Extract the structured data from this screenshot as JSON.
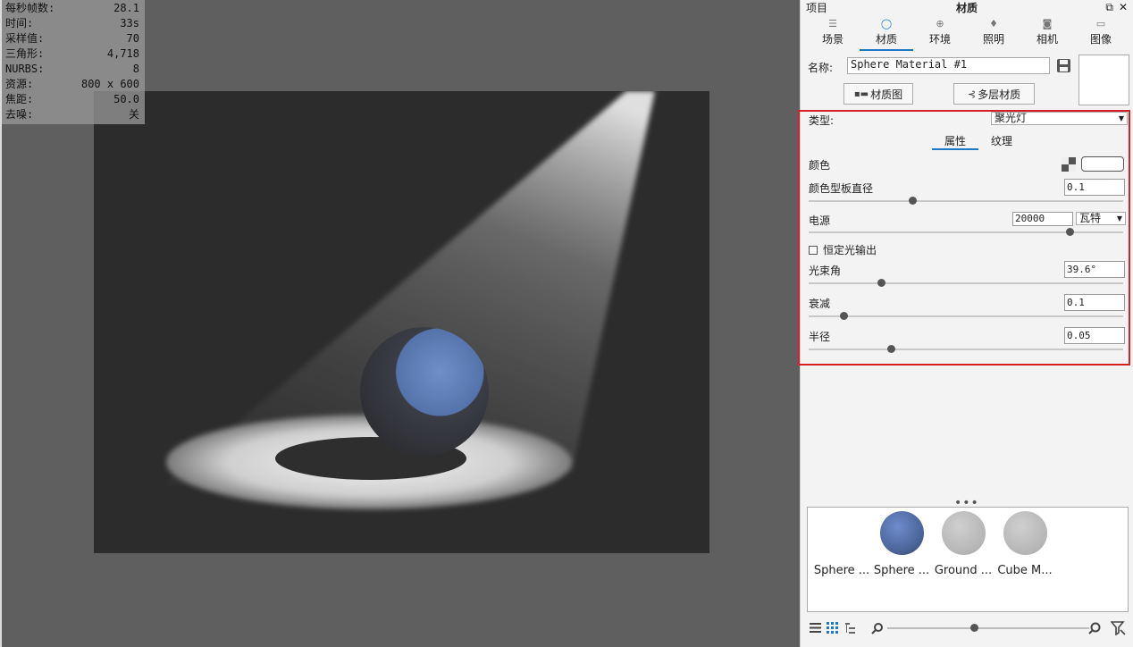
{
  "stats": [
    {
      "label": "每秒帧数:",
      "value": "28.1"
    },
    {
      "label": "时间:",
      "value": "33s"
    },
    {
      "label": "采样值:",
      "value": "70"
    },
    {
      "label": "三角形:",
      "value": "4,718"
    },
    {
      "label": "NURBS:",
      "value": "8"
    },
    {
      "label": "资源:",
      "value": "800 x 600"
    },
    {
      "label": "焦距:",
      "value": "50.0"
    },
    {
      "label": "去噪:",
      "value": "关"
    }
  ],
  "panel": {
    "left_title": "项目",
    "center_title": "材质",
    "win_restore": "⧉",
    "win_close": "✕",
    "tabs": [
      {
        "label": "场景",
        "icon": "list-icon"
      },
      {
        "label": "材质",
        "icon": "material-icon"
      },
      {
        "label": "环境",
        "icon": "globe-icon"
      },
      {
        "label": "照明",
        "icon": "bulb-icon"
      },
      {
        "label": "相机",
        "icon": "camera-icon"
      },
      {
        "label": "图像",
        "icon": "image-icon"
      }
    ],
    "name_label": "名称:",
    "name_value": "Sphere Material #1",
    "btn_graph": "材质图",
    "btn_multi": "多层材质"
  },
  "props": {
    "type_label": "类型:",
    "type_value": "聚光灯",
    "subtab_attrs": "属性",
    "subtab_texture": "纹理",
    "color_label": "颜色",
    "color_value": "#ffffff",
    "diameter_label": "颜色型板直径",
    "diameter_value": "0.1",
    "diameter_level": 0.33,
    "power_label": "电源",
    "power_value": "20000",
    "power_unit": "瓦特",
    "power_level": 0.83,
    "constant_label": "恒定光输出",
    "constant_checked": false,
    "beam_label": "光束角",
    "beam_value": "39.6°",
    "beam_level": 0.23,
    "falloff_label": "衰减",
    "falloff_value": "0.1",
    "falloff_level": 0.11,
    "radius_label": "半径",
    "radius_value": "0.05",
    "radius_level": 0.26
  },
  "library": {
    "more": "•••",
    "materials": [
      {
        "label": "Sphere ...",
        "color": "#ffffff"
      },
      {
        "label": "Sphere ...",
        "color": "#5573ab"
      },
      {
        "label": "Ground ...",
        "color": "#bdbdbd"
      },
      {
        "label": "Cube M...",
        "color": "#bdbdbd"
      }
    ],
    "zoom_level": 0.43
  },
  "colors": {
    "accent": "#1e78c8",
    "highlight_border": "#d62024",
    "sphere": "#5573ab"
  }
}
